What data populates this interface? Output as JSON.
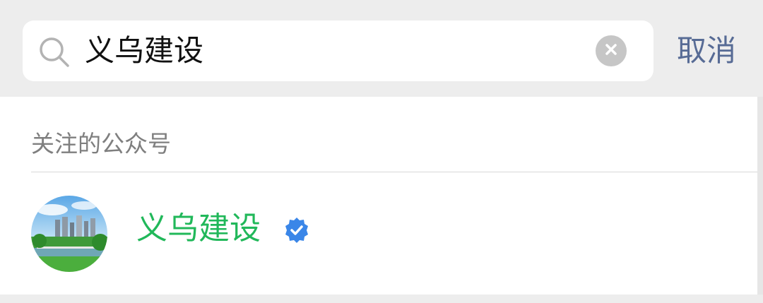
{
  "search": {
    "query": "义乌建设",
    "cancel_label": "取消"
  },
  "results": {
    "section_title": "关注的公众号",
    "accounts": [
      {
        "name": "义乌建设",
        "verified": true
      }
    ]
  },
  "icons": {
    "search": "search-icon",
    "clear": "clear-icon",
    "verified": "verified-badge-icon"
  },
  "colors": {
    "background": "#ededed",
    "accent_link": "#576b95",
    "account_name": "#21b85a",
    "verified_blue": "#3a86e8",
    "secondary_text": "#7f7f7f"
  }
}
